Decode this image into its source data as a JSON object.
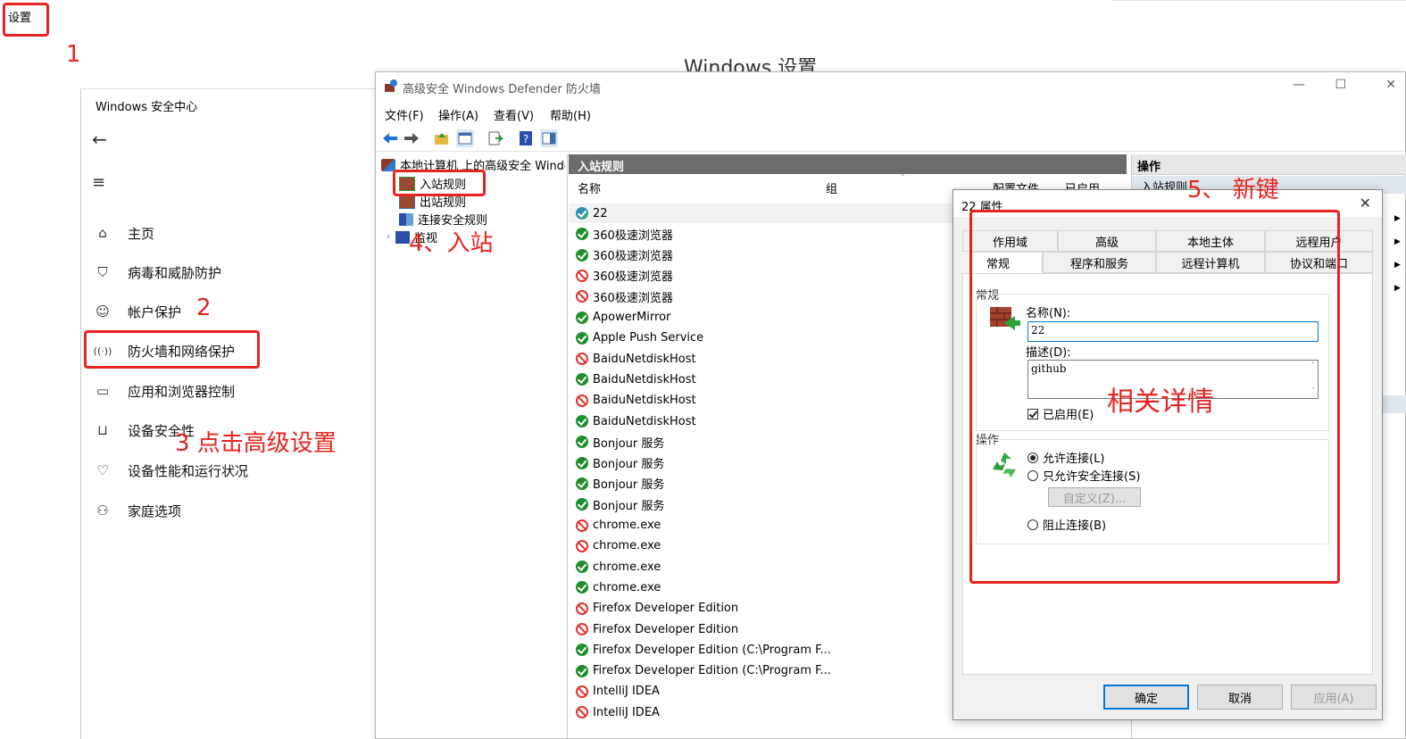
{
  "settings": {
    "label": "设置",
    "windows_settings_title": "Windows 设置"
  },
  "security_center": {
    "title": "Windows 安全中心",
    "nav": [
      {
        "label": "主页",
        "icon": "home-icon"
      },
      {
        "label": "病毒和威胁防护",
        "icon": "shield-icon"
      },
      {
        "label": "帐户保护",
        "icon": "person-icon"
      },
      {
        "label": "防火墙和网络保护",
        "icon": "wifi-signal-icon"
      },
      {
        "label": "应用和浏览器控制",
        "icon": "app-window-icon"
      },
      {
        "label": "设备安全性",
        "icon": "laptop-icon"
      },
      {
        "label": "设备性能和运行状况",
        "icon": "heart-icon"
      },
      {
        "label": "家庭选项",
        "icon": "family-icon"
      }
    ]
  },
  "firewall": {
    "title": "高级安全 Windows Defender 防火墙",
    "menu": [
      "文件(F)",
      "操作(A)",
      "查看(V)",
      "帮助(H)"
    ],
    "tree": {
      "root": "本地计算机 上的高级安全 Windows",
      "items": [
        "入站规则",
        "出站规则",
        "连接安全规则",
        "监视"
      ]
    },
    "rules_header": "入站规则",
    "columns": {
      "name": "名称",
      "group": "组",
      "profile": "配置文件",
      "enabled": "已启用"
    },
    "rules": [
      {
        "name": "22",
        "status": "special"
      },
      {
        "name": "360极速浏览器",
        "status": "allow"
      },
      {
        "name": "360极速浏览器",
        "status": "allow"
      },
      {
        "name": "360极速浏览器",
        "status": "block"
      },
      {
        "name": "360极速浏览器",
        "status": "block"
      },
      {
        "name": "ApowerMirror",
        "status": "allow"
      },
      {
        "name": "Apple Push Service",
        "status": "allow"
      },
      {
        "name": "BaiduNetdiskHost",
        "status": "block"
      },
      {
        "name": "BaiduNetdiskHost",
        "status": "allow"
      },
      {
        "name": "BaiduNetdiskHost",
        "status": "block"
      },
      {
        "name": "BaiduNetdiskHost",
        "status": "allow"
      },
      {
        "name": "Bonjour 服务",
        "status": "allow"
      },
      {
        "name": "Bonjour 服务",
        "status": "allow"
      },
      {
        "name": "Bonjour 服务",
        "status": "allow"
      },
      {
        "name": "Bonjour 服务",
        "status": "allow"
      },
      {
        "name": "chrome.exe",
        "status": "block"
      },
      {
        "name": "chrome.exe",
        "status": "block"
      },
      {
        "name": "chrome.exe",
        "status": "allow"
      },
      {
        "name": "chrome.exe",
        "status": "allow"
      },
      {
        "name": "Firefox Developer Edition",
        "status": "block"
      },
      {
        "name": "Firefox Developer Edition",
        "status": "block"
      },
      {
        "name": "Firefox Developer Edition (C:\\Program F...",
        "status": "allow"
      },
      {
        "name": "Firefox Developer Edition (C:\\Program F...",
        "status": "allow"
      },
      {
        "name": "IntelliJ IDEA",
        "status": "block"
      },
      {
        "name": "IntelliJ IDEA",
        "status": "block"
      }
    ],
    "actions_header": "操作",
    "actions_first": "入站规则"
  },
  "dialog": {
    "title": "22 属性",
    "tabs_row1": [
      "作用域",
      "高级",
      "本地主体",
      "远程用户"
    ],
    "tabs_row2": [
      "常规",
      "程序和服务",
      "远程计算机",
      "协议和端口"
    ],
    "group_general": "常规",
    "name_label": "名称(N):",
    "name_value": "22",
    "desc_label": "描述(D):",
    "desc_value": "github",
    "enabled_label": "已启用(E)",
    "group_action": "操作",
    "allow_label": "允许连接(L)",
    "secure_label": "只允许安全连接(S)",
    "customize_label": "自定义(Z)...",
    "block_label": "阻止连接(B)",
    "ok": "确定",
    "cancel": "取消",
    "apply": "应用(A)"
  },
  "annotations": {
    "n1": "1",
    "n2": "2",
    "n3": "3 点击高级设置",
    "n4": "4、入站",
    "n5": "5、 新键",
    "details": "相关详情"
  },
  "colors": {
    "annotation": "#e8231f",
    "allow": "#1e8f2e",
    "block": "#e2342f",
    "focus": "#0078d7"
  }
}
